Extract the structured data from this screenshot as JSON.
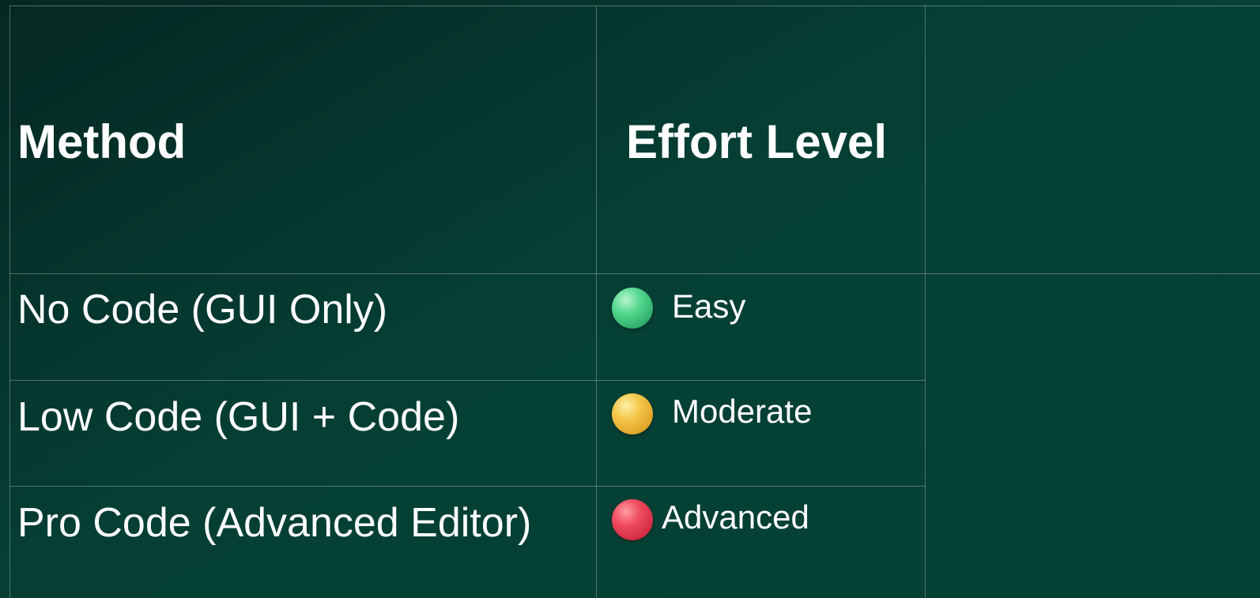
{
  "table": {
    "headers": {
      "method": "Method",
      "effort": "Effort Level",
      "extra": ""
    },
    "rows": [
      {
        "method": "No Code (GUI Only)",
        "effort": "Easy",
        "indicator_color": "#4cd486",
        "indicator_icon": "green-circle-icon"
      },
      {
        "method": "Low Code (GUI + Code)",
        "effort": "Moderate",
        "indicator_color": "#f0bd3f",
        "indicator_icon": "yellow-circle-icon"
      },
      {
        "method": "Pro Code (Advanced Editor)",
        "effort": "Advanced",
        "indicator_color": "#e8405a",
        "indicator_icon": "red-circle-icon"
      }
    ]
  },
  "colors": {
    "background": "#053f34",
    "grid_line": "#7f8c86",
    "text": "#ffffff"
  }
}
